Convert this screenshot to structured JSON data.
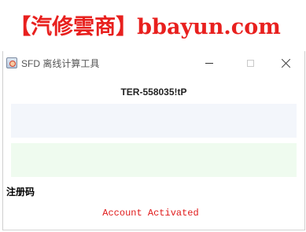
{
  "watermark": {
    "text": "【汽修雲商】bbayun.com"
  },
  "window": {
    "title": "SFD 离线计算工具",
    "app_icon": "java-app-icon",
    "controls": {
      "minimize_icon": "minimize-icon",
      "maximize_icon": "maximize-icon",
      "close_icon": "close-icon"
    }
  },
  "main": {
    "machine_code": "TER-558035!tP",
    "input_top_value": "",
    "input_bottom_value": "",
    "register_label": "注册码",
    "status_text": "Account Activated"
  },
  "colors": {
    "watermark": "#e8201e",
    "status": "#e01a1a",
    "input_top_bg": "#f3f6fb",
    "input_bottom_bg": "#effbef"
  }
}
